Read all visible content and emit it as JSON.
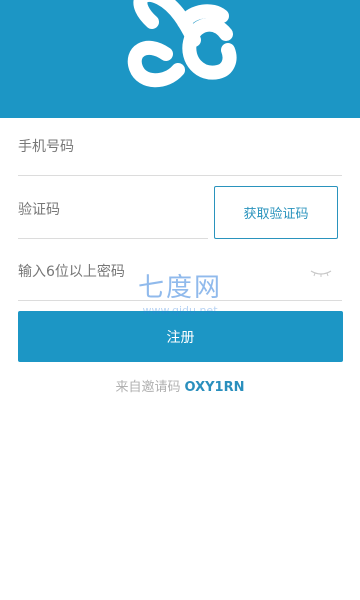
{
  "colors": {
    "brand": "#1c96c5",
    "link": "#2a8fbd"
  },
  "header": {
    "logo_icon": "brand-logo-icon"
  },
  "form": {
    "phone_placeholder": "手机号码",
    "code_placeholder": "验证码",
    "get_code_label": "获取验证码",
    "password_placeholder": "输入6位以上密码",
    "password_toggle_icon": "closed-eye-icon",
    "register_label": "注册"
  },
  "invite": {
    "label": "来自邀请码",
    "code": "OXY1RN"
  },
  "watermark": {
    "text": "七度网",
    "url": "www.qidu.net"
  }
}
